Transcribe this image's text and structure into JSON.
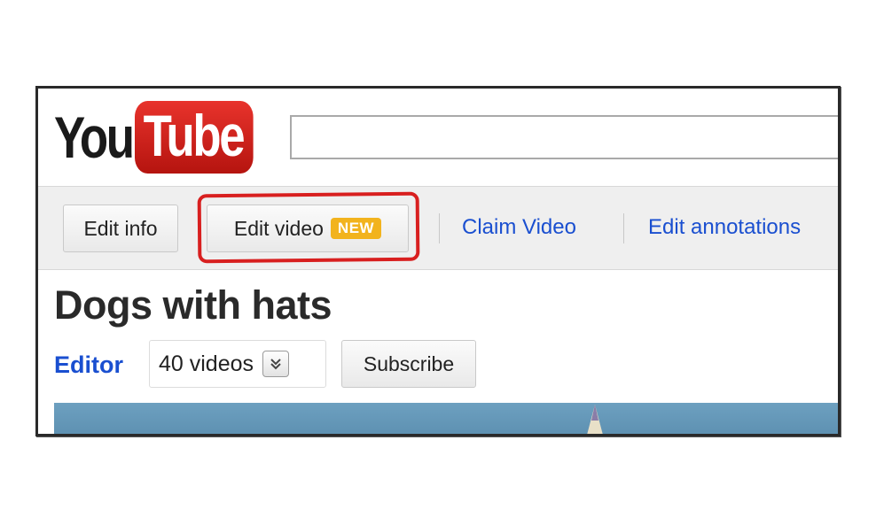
{
  "logo": {
    "you": "You",
    "tube": "Tube"
  },
  "toolbar": {
    "edit_info": "Edit info",
    "edit_video": "Edit video",
    "new_badge": "NEW",
    "claim_video": "Claim Video",
    "edit_annotations": "Edit annotations"
  },
  "channel": {
    "title": "Dogs with hats",
    "editor_label": "Editor",
    "videos_count": "40 videos",
    "subscribe": "Subscribe"
  },
  "colors": {
    "link": "#1a4fd0",
    "logo_red": "#d7261e",
    "badge": "#f2b31d",
    "highlight": "#d81f1f"
  }
}
